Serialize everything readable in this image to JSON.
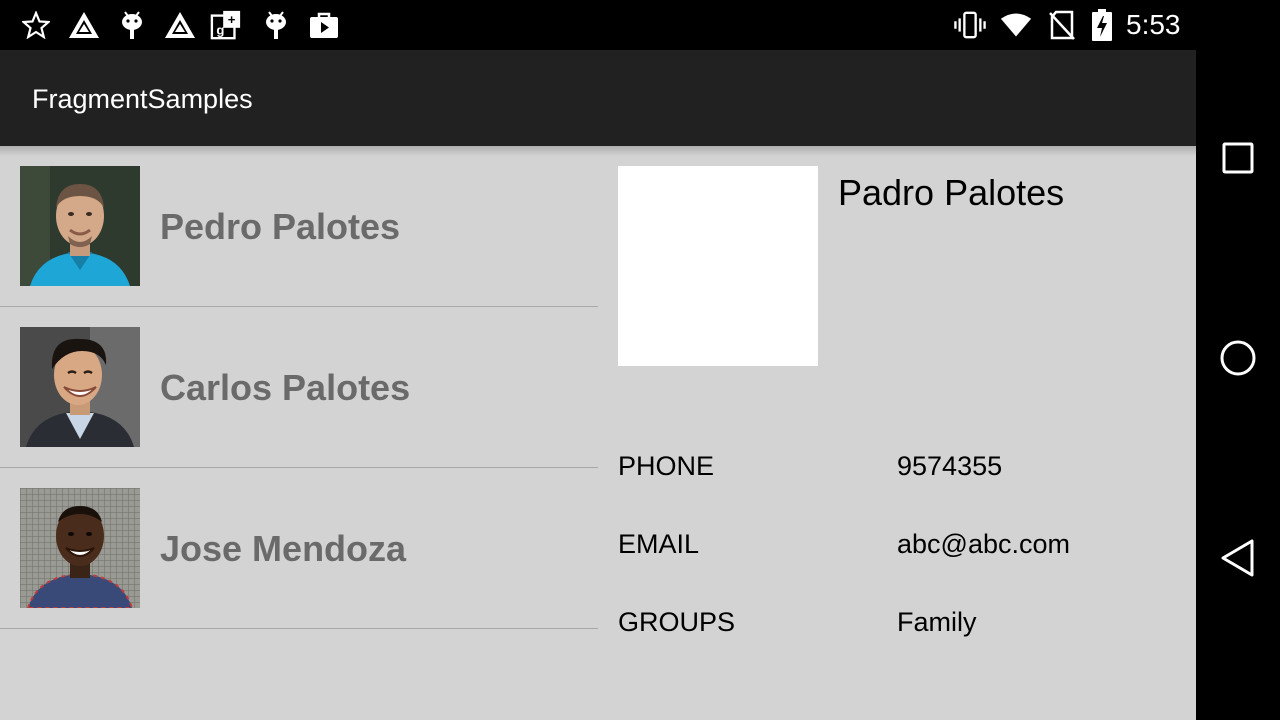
{
  "status_bar": {
    "time": "5:53",
    "left_icons": [
      "star-icon",
      "drive-icon",
      "android-icon",
      "drive-icon",
      "google-plus-icon",
      "android-icon",
      "play-store-icon"
    ],
    "right_icons": [
      "vibrate-icon",
      "wifi-icon",
      "no-sim-icon",
      "battery-charging-icon"
    ]
  },
  "app": {
    "title": "FragmentSamples"
  },
  "contacts": [
    {
      "name": "Pedro Palotes"
    },
    {
      "name": "Carlos Palotes"
    },
    {
      "name": "Jose Mendoza"
    }
  ],
  "detail": {
    "name": "Padro Palotes",
    "fields": [
      {
        "label": "PHONE",
        "value": "9574355"
      },
      {
        "label": "EMAIL",
        "value": "abc@abc.com"
      },
      {
        "label": "GROUPS",
        "value": "Family"
      }
    ]
  },
  "nav_bar": {
    "buttons": [
      "recents-icon",
      "home-icon",
      "back-icon"
    ]
  }
}
